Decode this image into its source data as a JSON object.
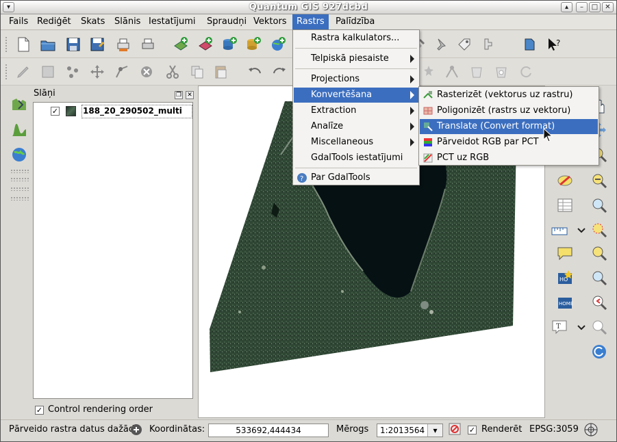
{
  "window": {
    "title": "Quantum GIS 927dcbd"
  },
  "menubar": {
    "items": [
      "Fails",
      "Rediģēt",
      "Skats",
      "Slānis",
      "Iestatījumi",
      "Spraudņi",
      "Vektors",
      "Rastrs",
      "Palīdzība"
    ],
    "active": "Rastrs"
  },
  "raster_menu": {
    "items": [
      {
        "label": "Rastra kalkulators...",
        "submenu": false
      },
      {
        "label": "Telpiskā piesaiste",
        "submenu": true
      },
      {
        "label": "Projections",
        "submenu": true
      },
      {
        "label": "Konvertēšana",
        "submenu": true,
        "highlighted": true
      },
      {
        "label": "Extraction",
        "submenu": true
      },
      {
        "label": "Analīze",
        "submenu": true
      },
      {
        "label": "Miscellaneous",
        "submenu": true
      },
      {
        "label": "GdalTools iestatījumi",
        "submenu": false
      },
      {
        "label": "Par GdalTools",
        "submenu": false
      }
    ]
  },
  "conversion_submenu": {
    "items": [
      {
        "label": "Rasterizēt (vektorus uz rastru)",
        "icon": "rasterize-icon"
      },
      {
        "label": "Poligonizēt (rastrs uz vektoru)",
        "icon": "polygonize-icon"
      },
      {
        "label": "Translate (Convert format)",
        "icon": "translate-icon",
        "highlighted": true
      },
      {
        "label": "Pārveidot RGB par PCT",
        "icon": "rgb-to-pct-icon"
      },
      {
        "label": "PCT uz RGB",
        "icon": "pct-to-rgb-icon"
      }
    ]
  },
  "layers_panel": {
    "title": "Slāņi",
    "layers": [
      {
        "name": "188_20_290502_multi",
        "checked": true
      }
    ],
    "control_rendering_order": {
      "label": "Control rendering order",
      "checked": true
    }
  },
  "statusbar": {
    "message": "Pārveido rastra datus dažād",
    "coords_label": "Koordinātas:",
    "coords_value": "533692,444434",
    "scale_label": "Mērogs",
    "scale_value": "1:2013564",
    "render_label": "Renderēt",
    "render_checked": true,
    "crs": "EPSG:3059"
  },
  "colors": {
    "highlight": "#3b6ebf",
    "lake": "#061114",
    "land": "#2f4634"
  }
}
